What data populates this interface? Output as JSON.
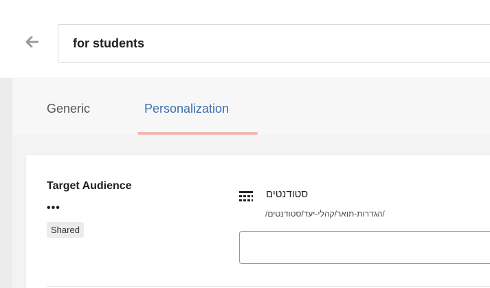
{
  "header": {
    "title_value": "for students"
  },
  "tabs": [
    {
      "label": "Generic",
      "active": false
    },
    {
      "label": "Personalization",
      "active": true
    }
  ],
  "target_audience": {
    "title": "Target Audience",
    "more_label": "•••",
    "badge": "Shared",
    "item": {
      "icon": "grid-table-icon",
      "name": "סטודנטים",
      "path": "/הגדרות-תואר/קהלי-יעד/סטודנטים/"
    },
    "search_value": ""
  },
  "colors": {
    "accent_blue": "#3a6fb0",
    "tab_underline": "#f1b7ae",
    "input_border": "#6a9fd8"
  }
}
